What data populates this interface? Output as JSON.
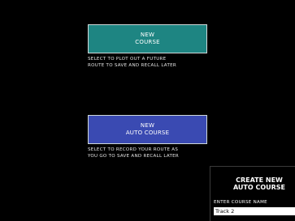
{
  "colors": {
    "background": "#000000",
    "course_button": "#1e8582",
    "auto_course_button": "#3a4ab2",
    "text": "#ffffff",
    "input_background": "#ffffff",
    "input_text": "#000000"
  },
  "new_course": {
    "label_line1": "NEW",
    "label_line2": "COURSE",
    "description_line1": "SELECT TO PLOT OUT A FUTURE",
    "description_line2": "ROUTE TO SAVE AND RECALL LATER"
  },
  "new_auto_course": {
    "label_line1": "NEW",
    "label_line2": "AUTO COURSE",
    "description_line1": "SELECT TO RECORD YOUR ROUTE AS",
    "description_line2": "YOU GO TO SAVE AND RECALL LATER"
  },
  "create_dialog": {
    "title_line1": "CREATE NEW",
    "title_line2": "AUTO COURSE",
    "name_label": "ENTER COURSE NAME",
    "name_value": "Track 2"
  }
}
